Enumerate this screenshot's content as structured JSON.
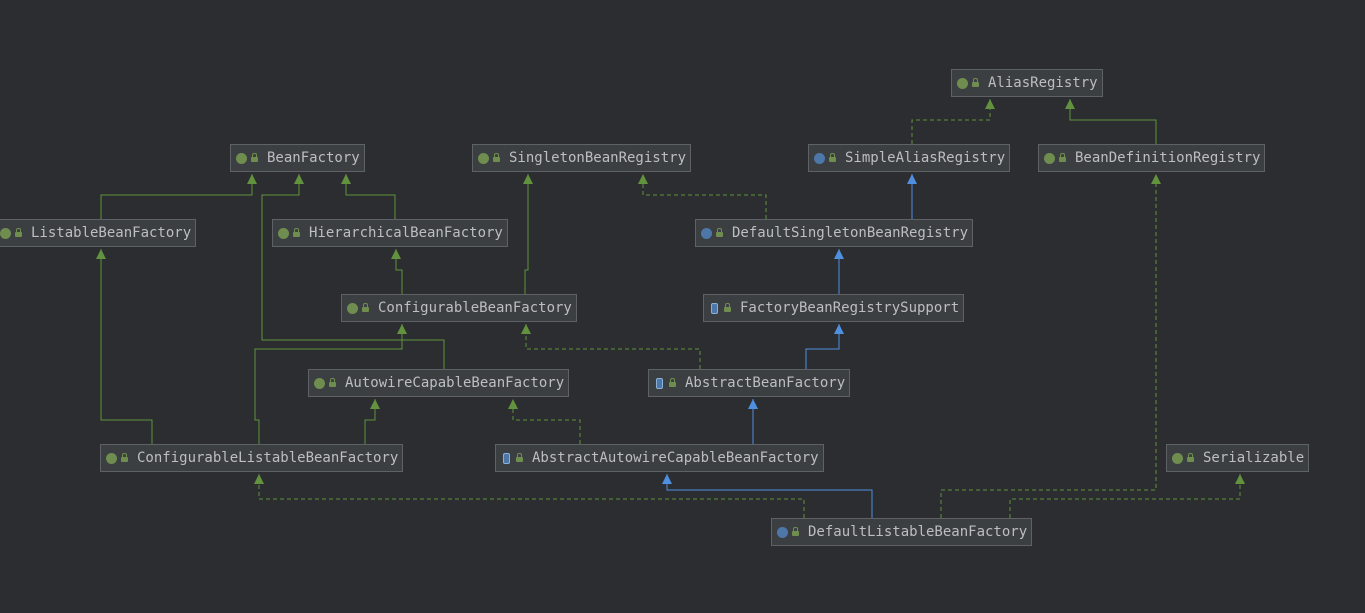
{
  "diagram": {
    "nodes": [
      {
        "id": "AliasRegistry",
        "label": "AliasRegistry",
        "kind": "interface"
      },
      {
        "id": "BeanFactory",
        "label": "BeanFactory",
        "kind": "interface"
      },
      {
        "id": "SingletonBeanRegistry",
        "label": "SingletonBeanRegistry",
        "kind": "interface"
      },
      {
        "id": "SimpleAliasRegistry",
        "label": "SimpleAliasRegistry",
        "kind": "class"
      },
      {
        "id": "BeanDefinitionRegistry",
        "label": "BeanDefinitionRegistry",
        "kind": "interface"
      },
      {
        "id": "ListableBeanFactory",
        "label": "ListableBeanFactory",
        "kind": "interface"
      },
      {
        "id": "HierarchicalBeanFactory",
        "label": "HierarchicalBeanFactory",
        "kind": "interface"
      },
      {
        "id": "DefaultSingletonBeanRegistry",
        "label": "DefaultSingletonBeanRegistry",
        "kind": "class"
      },
      {
        "id": "ConfigurableBeanFactory",
        "label": "ConfigurableBeanFactory",
        "kind": "interface"
      },
      {
        "id": "FactoryBeanRegistrySupport",
        "label": "FactoryBeanRegistrySupport",
        "kind": "abstract"
      },
      {
        "id": "AutowireCapableBeanFactory",
        "label": "AutowireCapableBeanFactory",
        "kind": "interface"
      },
      {
        "id": "AbstractBeanFactory",
        "label": "AbstractBeanFactory",
        "kind": "abstract"
      },
      {
        "id": "ConfigurableListableBeanFactory",
        "label": "ConfigurableListableBeanFactory",
        "kind": "interface"
      },
      {
        "id": "AbstractAutowireCapableBeanFactory",
        "label": "AbstractAutowireCapableBeanFactory",
        "kind": "abstract"
      },
      {
        "id": "Serializable",
        "label": "Serializable",
        "kind": "interface"
      },
      {
        "id": "DefaultListableBeanFactory",
        "label": "DefaultListableBeanFactory",
        "kind": "class"
      }
    ],
    "edges": [
      {
        "from": "SimpleAliasRegistry",
        "to": "AliasRegistry",
        "type": "implements"
      },
      {
        "from": "BeanDefinitionRegistry",
        "to": "AliasRegistry",
        "type": "extends-interface"
      },
      {
        "from": "ListableBeanFactory",
        "to": "BeanFactory",
        "type": "extends-interface"
      },
      {
        "from": "HierarchicalBeanFactory",
        "to": "BeanFactory",
        "type": "extends-interface"
      },
      {
        "from": "AutowireCapableBeanFactory",
        "to": "BeanFactory",
        "type": "extends-interface"
      },
      {
        "from": "ConfigurableBeanFactory",
        "to": "HierarchicalBeanFactory",
        "type": "extends-interface"
      },
      {
        "from": "ConfigurableBeanFactory",
        "to": "SingletonBeanRegistry",
        "type": "extends-interface"
      },
      {
        "from": "DefaultSingletonBeanRegistry",
        "to": "SingletonBeanRegistry",
        "type": "implements"
      },
      {
        "from": "DefaultSingletonBeanRegistry",
        "to": "SimpleAliasRegistry",
        "type": "extends"
      },
      {
        "from": "FactoryBeanRegistrySupport",
        "to": "DefaultSingletonBeanRegistry",
        "type": "extends"
      },
      {
        "from": "AbstractBeanFactory",
        "to": "FactoryBeanRegistrySupport",
        "type": "extends"
      },
      {
        "from": "AbstractBeanFactory",
        "to": "ConfigurableBeanFactory",
        "type": "implements"
      },
      {
        "from": "ConfigurableListableBeanFactory",
        "to": "ListableBeanFactory",
        "type": "extends-interface"
      },
      {
        "from": "ConfigurableListableBeanFactory",
        "to": "ConfigurableBeanFactory",
        "type": "extends-interface"
      },
      {
        "from": "ConfigurableListableBeanFactory",
        "to": "AutowireCapableBeanFactory",
        "type": "extends-interface"
      },
      {
        "from": "AbstractAutowireCapableBeanFactory",
        "to": "AbstractBeanFactory",
        "type": "extends"
      },
      {
        "from": "AbstractAutowireCapableBeanFactory",
        "to": "AutowireCapableBeanFactory",
        "type": "implements"
      },
      {
        "from": "DefaultListableBeanFactory",
        "to": "AbstractAutowireCapableBeanFactory",
        "type": "extends"
      },
      {
        "from": "DefaultListableBeanFactory",
        "to": "ConfigurableListableBeanFactory",
        "type": "implements"
      },
      {
        "from": "DefaultListableBeanFactory",
        "to": "BeanDefinitionRegistry",
        "type": "implements"
      },
      {
        "from": "DefaultListableBeanFactory",
        "to": "Serializable",
        "type": "implements"
      }
    ],
    "colors": {
      "background": "#2b2d30",
      "interface_edge": "#62923d",
      "class_edge": "#4f8fe0",
      "node_fill": "#3c3f41",
      "node_border": "#5e6266",
      "text": "#bcbec4"
    }
  }
}
